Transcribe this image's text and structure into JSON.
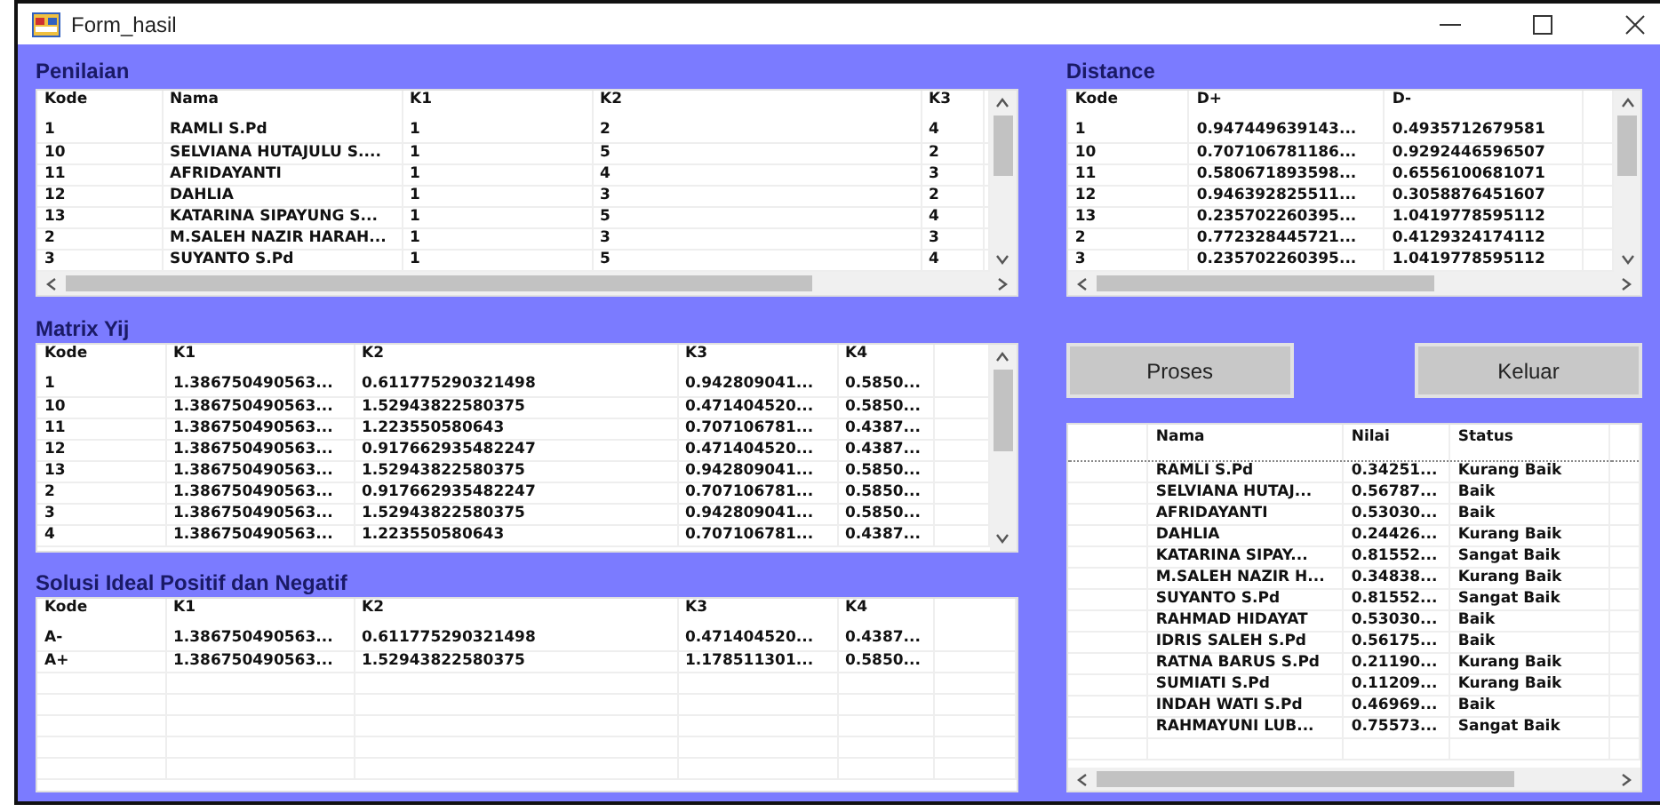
{
  "window": {
    "title": "Form_hasil"
  },
  "penilaian": {
    "title": "Penilaian",
    "columns": [
      "Kode",
      "Nama",
      "K1",
      "K2",
      "K3"
    ],
    "rows": [
      [
        "1",
        "RAMLI S.Pd",
        "1",
        "2",
        "4"
      ],
      [
        "10",
        "SELVIANA HUTAJULU S....",
        "1",
        "5",
        "2"
      ],
      [
        "11",
        "AFRIDAYANTI",
        "1",
        "4",
        "3"
      ],
      [
        "12",
        "DAHLIA",
        "1",
        "3",
        "2"
      ],
      [
        "13",
        "KATARINA SIPAYUNG S...",
        "1",
        "5",
        "4"
      ],
      [
        "2",
        "M.SALEH NAZIR HARAH...",
        "1",
        "3",
        "3"
      ],
      [
        "3",
        "SUYANTO S.Pd",
        "1",
        "5",
        "4"
      ]
    ]
  },
  "distance": {
    "title": "Distance",
    "columns": [
      "Kode",
      "D+",
      "D-"
    ],
    "rows": [
      [
        "1",
        "0.947449639143...",
        "0.4935712679581"
      ],
      [
        "10",
        "0.707106781186...",
        "0.9292446596507"
      ],
      [
        "11",
        "0.580671893598...",
        "0.6556100681071"
      ],
      [
        "12",
        "0.946392825511...",
        "0.3058876451607"
      ],
      [
        "13",
        "0.235702260395...",
        "1.0419778595112"
      ],
      [
        "2",
        "0.772328445721...",
        "0.4129324174112"
      ],
      [
        "3",
        "0.235702260395...",
        "1.0419778595112"
      ]
    ]
  },
  "matrix": {
    "title": "Matrix Yij",
    "columns": [
      "Kode",
      "K1",
      "K2",
      "K3",
      "K4"
    ],
    "rows": [
      [
        "1",
        "1.386750490563...",
        "0.611775290321498",
        "0.942809041...",
        "0.5850..."
      ],
      [
        "10",
        "1.386750490563...",
        "1.52943822580375",
        "0.471404520...",
        "0.5850..."
      ],
      [
        "11",
        "1.386750490563...",
        "1.223550580643",
        "0.707106781...",
        "0.4387..."
      ],
      [
        "12",
        "1.386750490563...",
        "0.917662935482247",
        "0.471404520...",
        "0.4387..."
      ],
      [
        "13",
        "1.386750490563...",
        "1.52943822580375",
        "0.942809041...",
        "0.5850..."
      ],
      [
        "2",
        "1.386750490563...",
        "0.917662935482247",
        "0.707106781...",
        "0.5850..."
      ],
      [
        "3",
        "1.386750490563...",
        "1.52943822580375",
        "0.942809041...",
        "0.5850..."
      ],
      [
        "4",
        "1.386750490563...",
        "1.223550580643",
        "0.707106781...",
        "0.4387..."
      ]
    ]
  },
  "solusi": {
    "title": "Solusi Ideal Positif dan Negatif",
    "columns": [
      "Kode",
      "K1",
      "K2",
      "K3",
      "K4"
    ],
    "rows": [
      [
        "A-",
        "1.386750490563...",
        "0.611775290321498",
        "0.471404520...",
        "0.4387..."
      ],
      [
        "A+",
        "1.386750490563...",
        "1.52943822580375",
        "1.178511301...",
        "0.5850..."
      ]
    ]
  },
  "buttons": [
    "Proses",
    "Keluar"
  ],
  "hasil": {
    "columns": [
      "Nama",
      "Nilai",
      "Status"
    ],
    "rows": [
      [
        "RAMLI S.Pd",
        "0.34251...",
        "Kurang Baik"
      ],
      [
        "SELVIANA HUTAJ...",
        "0.56787...",
        "Baik"
      ],
      [
        "AFRIDAYANTI",
        "0.53030...",
        "Baik"
      ],
      [
        "DAHLIA",
        "0.24426...",
        "Kurang Baik"
      ],
      [
        "KATARINA SIPAY...",
        "0.81552...",
        "Sangat Baik"
      ],
      [
        "M.SALEH NAZIR H...",
        "0.34838...",
        "Kurang Baik"
      ],
      [
        "SUYANTO S.Pd",
        "0.81552...",
        "Sangat Baik"
      ],
      [
        "RAHMAD HIDAYAT",
        "0.53030...",
        "Baik"
      ],
      [
        "IDRIS SALEH S.Pd",
        "0.56175...",
        "Baik"
      ],
      [
        "RATNA BARUS S.Pd",
        "0.21190...",
        "Kurang Baik"
      ],
      [
        "SUMIATI S.Pd",
        "0.11209...",
        "Kurang Baik"
      ],
      [
        "INDAH WATI S.Pd",
        "0.46969...",
        "Baik"
      ],
      [
        "RAHMAYUNI LUB...",
        "0.75573...",
        "Sangat Baik"
      ]
    ]
  }
}
